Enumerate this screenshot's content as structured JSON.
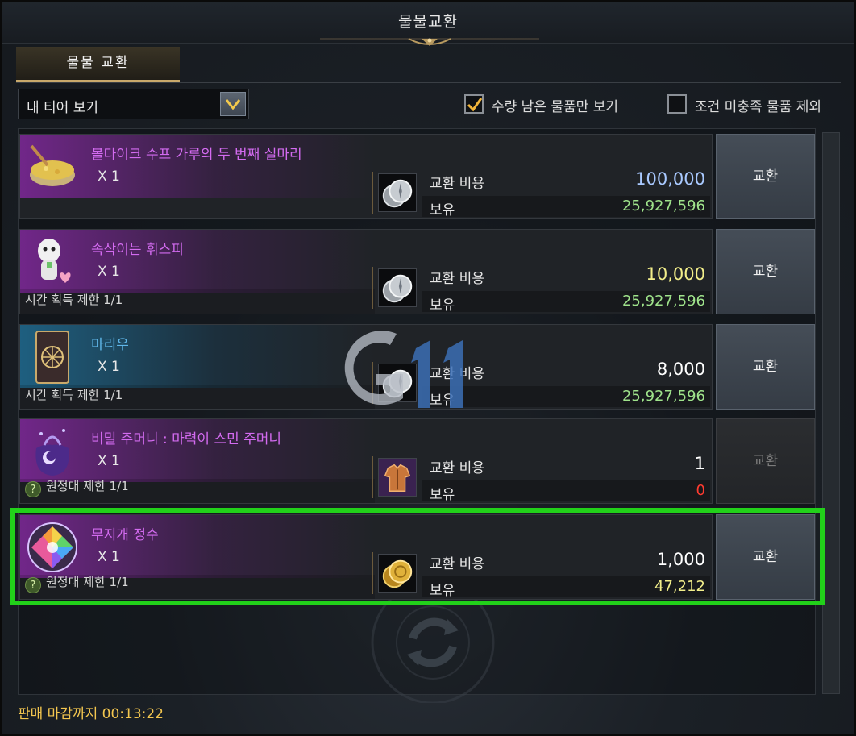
{
  "window": {
    "title": "물물교환"
  },
  "tabs": [
    {
      "label": "물물 교환",
      "active": true
    }
  ],
  "filter": {
    "dropdown_value": "내 티어 보기",
    "checkbox1": {
      "label": "수량 남은 물품만 보기",
      "checked": true
    },
    "checkbox2": {
      "label": "조건 미충족 물품 제외",
      "checked": false
    }
  },
  "cost_label": "교환 비용",
  "owned_label": "보유",
  "exchange_label": "교환",
  "items": [
    {
      "name": "볼다이크 수프 가루의 두 번째 실마리",
      "name_color": "#d36bf0",
      "qty": "X 1",
      "limit": "",
      "cost": "100,000",
      "cost_color": "#a9c9ff",
      "owned": "25,927,596",
      "owned_color": "#9fe38b",
      "currency_icon": "silver-coin-icon",
      "item_icon": "soup-bowl-icon",
      "enabled": true
    },
    {
      "name": "속삭이는 휘스피",
      "name_color": "#d36bf0",
      "qty": "X 1",
      "limit": "시간 획득 제한 1/1",
      "cost": "10,000",
      "cost_color": "#f2ee8a",
      "owned": "25,927,596",
      "owned_color": "#9fe38b",
      "currency_icon": "silver-coin-icon",
      "item_icon": "ghost-doll-icon",
      "enabled": true
    },
    {
      "name": "마리우",
      "name_color": "#5fb6e8",
      "qty": "X 1",
      "limit": "시간 획득 제한 1/1",
      "cost": "8,000",
      "cost_color": "#ffffff",
      "owned": "25,927,596",
      "owned_color": "#9fe38b",
      "currency_icon": "silver-coin-icon",
      "item_icon": "card-icon",
      "enabled": true
    },
    {
      "name": "비밀 주머니 : 마력이 스민 주머니",
      "name_color": "#d36bf0",
      "qty": "X 1",
      "limit": "원정대 제한 1/1",
      "cost": "1",
      "cost_color": "#ffffff",
      "owned": "0",
      "owned_color": "#ff3b30",
      "currency_icon": "armor-icon",
      "item_icon": "magic-pouch-icon",
      "enabled": false
    },
    {
      "name": "무지개 정수",
      "name_color": "#d36bf0",
      "qty": "X 1",
      "limit": "원정대 제한 1/1",
      "cost": "1,000",
      "cost_color": "#ffffff",
      "owned": "47,212",
      "owned_color": "#f2ee8a",
      "currency_icon": "gold-coin-icon",
      "item_icon": "rainbow-gem-icon",
      "enabled": true
    }
  ],
  "footer": {
    "timer": "판매 마감까지 00:13:22"
  },
  "watermark": {
    "text": "G11"
  }
}
